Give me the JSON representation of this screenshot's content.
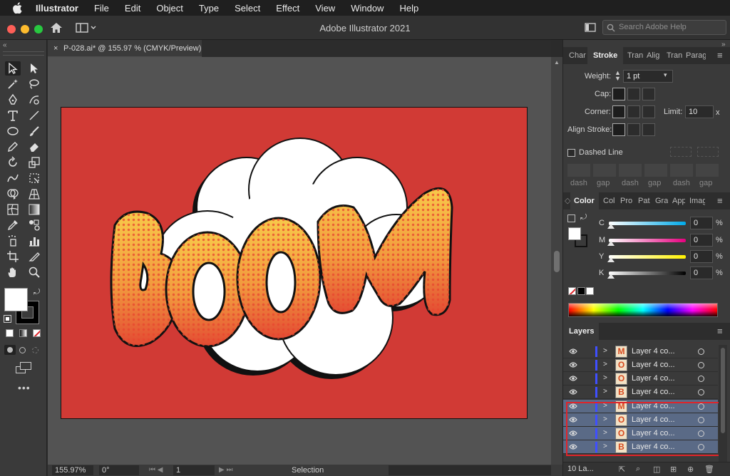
{
  "menubar": {
    "app_name": "Illustrator",
    "items": [
      "File",
      "Edit",
      "Object",
      "Type",
      "Select",
      "Effect",
      "View",
      "Window",
      "Help"
    ]
  },
  "titlebar": {
    "title": "Adobe Illustrator 2021",
    "search_placeholder": "Search Adobe Help"
  },
  "document": {
    "tab_label": "P-028.ai* @ 155.97 % (CMYK/Preview)",
    "artwork_text": "BOOM",
    "colors": {
      "artboard": "#d13a35",
      "letters_top": "#f8c94a",
      "letters_bottom": "#e8543a",
      "cloud": "#ffffff"
    }
  },
  "status": {
    "zoom": "155.97%",
    "rotation": "0°",
    "artboard_number": "1",
    "tool_name": "Selection"
  },
  "stroke_panel": {
    "tabs": [
      "Char",
      "Stroke",
      "Tran",
      "Alig",
      "Tran",
      "Parag"
    ],
    "weight_label": "Weight:",
    "weight_value": "1 pt",
    "cap_label": "Cap:",
    "corner_label": "Corner:",
    "limit_label": "Limit:",
    "limit_value": "10",
    "limit_unit": "x",
    "align_label": "Align Stroke:",
    "dashed_label": "Dashed Line",
    "dash_labels": [
      "dash",
      "gap",
      "dash",
      "gap",
      "dash",
      "gap"
    ]
  },
  "color_panel": {
    "tabs": [
      "Color",
      "Col",
      "Pro",
      "Pat",
      "Gra",
      "App",
      "Imag"
    ],
    "channels": [
      {
        "label": "C",
        "value": "0",
        "unit": "%"
      },
      {
        "label": "M",
        "value": "0",
        "unit": "%"
      },
      {
        "label": "Y",
        "value": "0",
        "unit": "%"
      },
      {
        "label": "K",
        "value": "0",
        "unit": "%"
      }
    ]
  },
  "layers_panel": {
    "title": "Layers",
    "rows": [
      {
        "name": "Layer 4 co...",
        "thumb": "M",
        "selected": false
      },
      {
        "name": "Layer 4 co...",
        "thumb": "O",
        "selected": false
      },
      {
        "name": "Layer 4 co...",
        "thumb": "O",
        "selected": false
      },
      {
        "name": "Layer 4 co...",
        "thumb": "B",
        "selected": false
      },
      {
        "name": "Layer 4 co...",
        "thumb": "M",
        "selected": true
      },
      {
        "name": "Layer 4 co...",
        "thumb": "O",
        "selected": true
      },
      {
        "name": "Layer 4 co...",
        "thumb": "O",
        "selected": true
      },
      {
        "name": "Layer 4 co...",
        "thumb": "B",
        "selected": true
      }
    ],
    "footer_count": "10 La...",
    "highlight_color": "#e0242a"
  }
}
